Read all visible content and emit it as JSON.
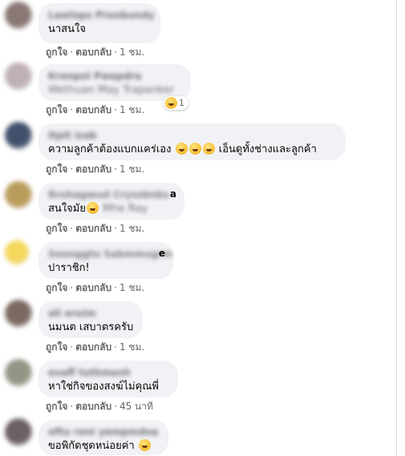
{
  "labels": {
    "like": "ถูกใจ",
    "reply": "ตอบกลับ",
    "dot": "·"
  },
  "comments": [
    {
      "name": "Lawlops Pronbundy",
      "text": "นาสนใจ",
      "time": "1 ชม.",
      "avatar": "#7d6a66"
    },
    {
      "name": "Krenpol Pwapdra",
      "text": "Wethuan May Trapanker",
      "text_blurred": true,
      "time": "1 ชม.",
      "avatar": "#b8a8b0",
      "reaction_count": "1"
    },
    {
      "name": "Itpit isab",
      "text": "ความลูกค้าต้องแบกแคร่เอง",
      "text_after": "เอ็นดูทั้งช่างและลูกค้า",
      "emoji_count": 3,
      "time": "1 ชม.",
      "avatar": "#2f3e5c"
    },
    {
      "name": "Rrohagwud Cryssbnbs",
      "name_suffix": "a",
      "text": "สนใจมัย",
      "mention": "Mhe Ray",
      "time": "1 ชม.",
      "avatar": "#b2924a"
    },
    {
      "name": "Soonggtu Sabmmugrm",
      "name_suffix": "e",
      "text": "ปาราชิก!",
      "time": "1 ชม.",
      "avatar": "#f3d34a"
    },
    {
      "name": "ali eruim",
      "text": "นมนต เสบาตรครับ",
      "time": "1 ชม.",
      "avatar": "#6e5a52"
    },
    {
      "name": "exaff tuthmesh",
      "text": "หาใช่กิจของสงฆ์ไม่คุณพี่",
      "time": "45 นาที",
      "avatar": "#8a8a7a"
    },
    {
      "name": "oftu reni yempmdoa",
      "text": "ขอพิกัดชุดหน่อยค่า",
      "time": "",
      "avatar": "#5b4f55"
    }
  ]
}
